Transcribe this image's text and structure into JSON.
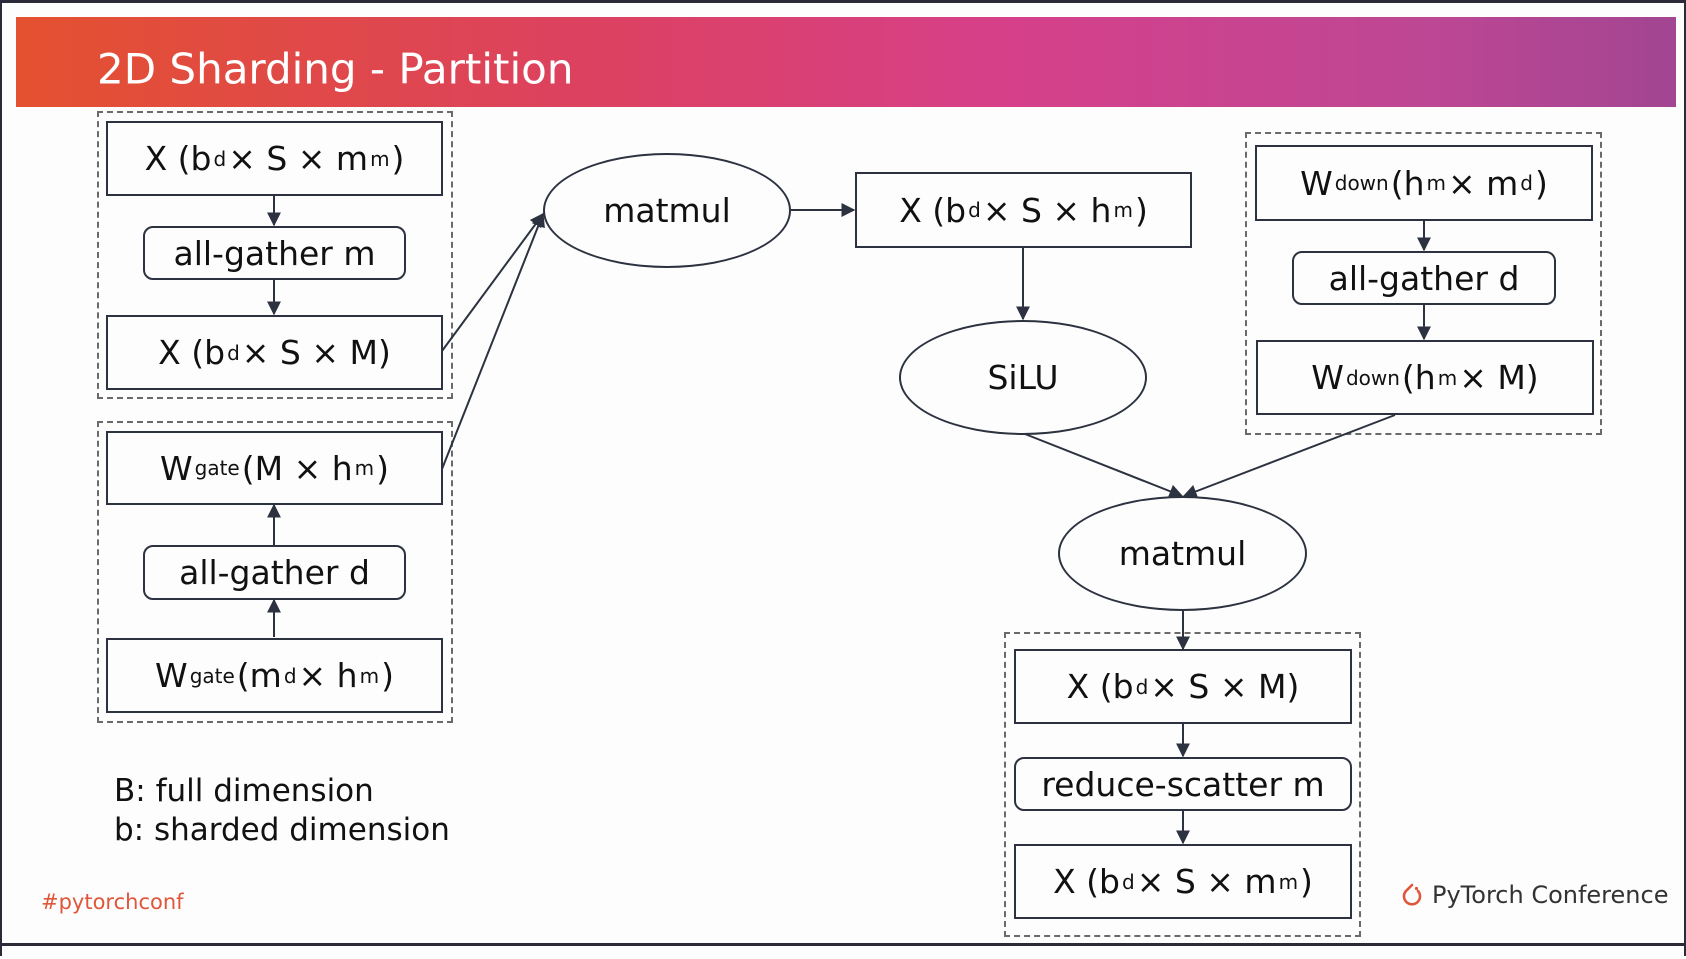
{
  "slide": {
    "title": "2D Sharding - Partition",
    "accent_gradient": [
      "#e4512f",
      "#d6408a",
      "#a24592"
    ]
  },
  "nodes": {
    "x_input": {
      "main": "X (b",
      "sub1": "d",
      "mid": " × S × m",
      "sub2": "m",
      "end": ")"
    },
    "allgather_m": {
      "label": "all-gather m"
    },
    "x_full": {
      "main": "X (b",
      "sub1": "d",
      "end": " × S × M)"
    },
    "wgate_full": {
      "main": "W",
      "sub1": "gate",
      "mid": " (M × h",
      "sub2": "m",
      "end": ")"
    },
    "allgather_d_left": {
      "label": "all-gather d"
    },
    "wgate_shard": {
      "main": "W",
      "sub1": "gate",
      "mid": " (m",
      "sub2": "d",
      "mid2": " × h",
      "sub3": "m",
      "end": ")"
    },
    "matmul_top": {
      "label": "matmul"
    },
    "x_hidden": {
      "main": "X (b",
      "sub1": "d",
      "mid": " × S × h",
      "sub2": "m",
      "end": ")"
    },
    "silu": {
      "label": "SiLU"
    },
    "wdown_shard": {
      "main": "W",
      "sub1": "down",
      "mid": " (h",
      "sub2": "m",
      "mid2": " × m",
      "sub3": "d",
      "end": ")"
    },
    "allgather_d_right": {
      "label": "all-gather d"
    },
    "wdown_full": {
      "main": "W",
      "sub1": "down",
      "mid": " (h",
      "sub2": "m",
      "end": " × M)"
    },
    "matmul_bottom": {
      "label": "matmul"
    },
    "x_out_full": {
      "main": "X (b",
      "sub1": "d",
      "end": " × S × M)"
    },
    "reduce_scatter_m": {
      "label": "reduce-scatter m"
    },
    "x_out": {
      "main": "X (b",
      "sub1": "d",
      "mid": " × S × m",
      "sub2": "m",
      "end": ")"
    }
  },
  "legend": {
    "line1": "B: full dimension",
    "line2": "b: sharded dimension"
  },
  "footer": {
    "hashtag": "#pytorchconf",
    "brand": "PyTorch Conference",
    "brand_icon": "pytorch-flame-icon",
    "hashtag_color": "#e0563a"
  }
}
